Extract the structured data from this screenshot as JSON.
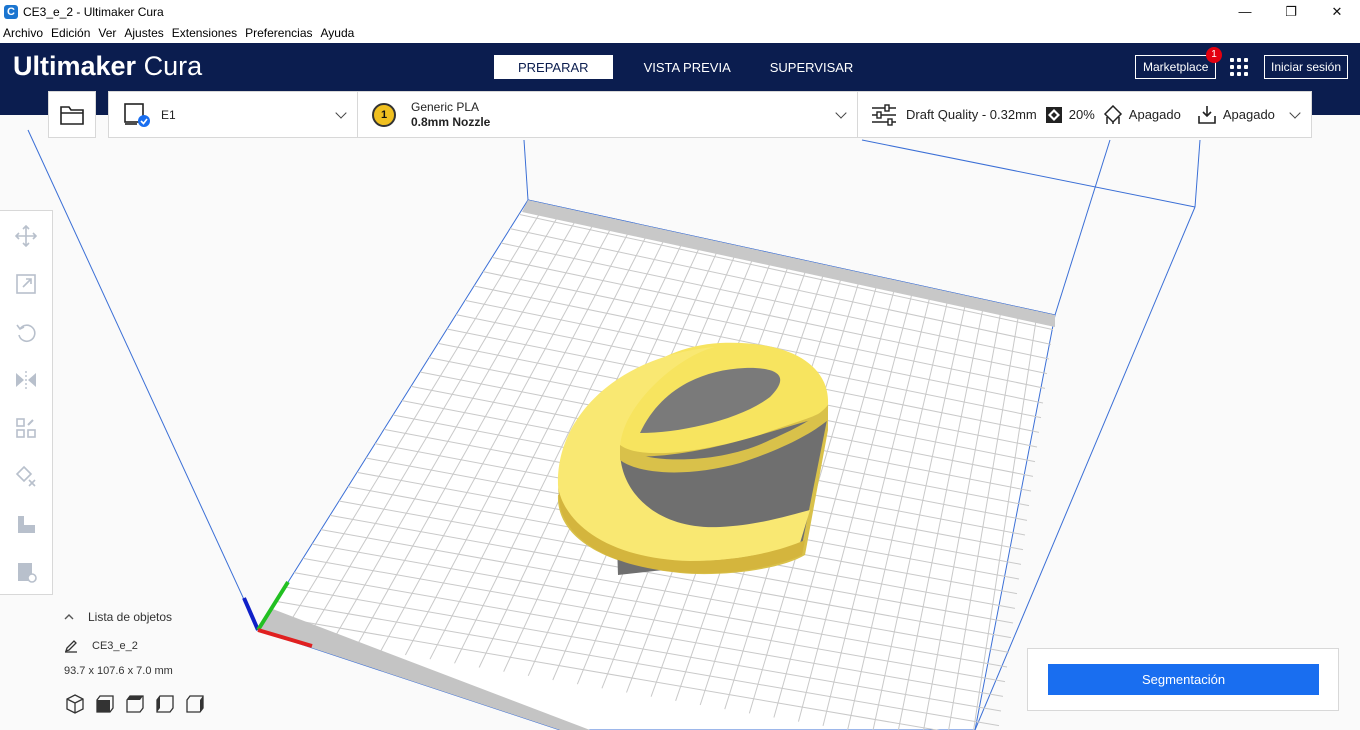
{
  "window": {
    "title": "CE3_e_2 - Ultimaker Cura",
    "minimize": "—",
    "restore": "❐",
    "close": "✕"
  },
  "menu": [
    "Archivo",
    "Edición",
    "Ver",
    "Ajustes",
    "Extensiones",
    "Preferencias",
    "Ayuda"
  ],
  "header": {
    "logo_bold": "Ultimaker",
    "logo_light": "Cura",
    "tabs": [
      "PREPARAR",
      "VISTA PREVIA",
      "SUPERVISAR"
    ],
    "active_tab": "PREPARAR",
    "marketplace": "Marketplace",
    "marketplace_badge": "1",
    "signin": "Iniciar sesión"
  },
  "toolbar": {
    "printer": "E1",
    "material_badge": "1",
    "material_name": "Generic PLA",
    "nozzle": "0.8mm Nozzle",
    "quality": "Draft Quality - 0.32mm",
    "infill": "20%",
    "support": "Apagado",
    "adhesion": "Apagado"
  },
  "objects": {
    "title": "Lista de objetos",
    "name": "CE3_e_2",
    "dimensions": "93.7 x 107.6 x 7.0 mm"
  },
  "slice": {
    "button": "Segmentación"
  },
  "colors": {
    "header_bg": "#0b1d4f",
    "accent": "#196ef0",
    "model": "#f7e45f",
    "badge": "#e3000f"
  }
}
